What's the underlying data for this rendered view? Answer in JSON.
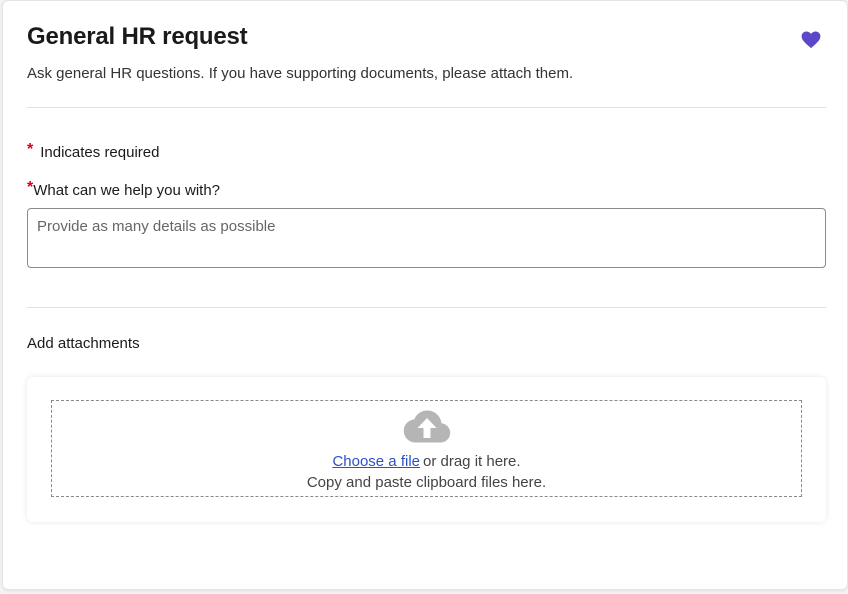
{
  "form": {
    "title": "General HR request",
    "subtitle": "Ask general HR questions. If you have supporting documents, please attach them.",
    "favorite_icon": "heart-icon",
    "favorite_color": "#5b47c7"
  },
  "required_note": {
    "marker": "*",
    "text": "Indicates required"
  },
  "question": {
    "marker": "*",
    "label": "What can we help you with?",
    "value": "",
    "placeholder": "Provide as many details as possible"
  },
  "attachments": {
    "label": "Add attachments",
    "upload_icon": "cloud-upload-icon",
    "choose_link": "Choose a file",
    "drag_text": "or drag it here.",
    "paste_text": "Copy and paste clipboard files here."
  },
  "colors": {
    "required": "#d6001c",
    "link": "#2b50c8",
    "icon_gray": "#b5b5b5"
  }
}
